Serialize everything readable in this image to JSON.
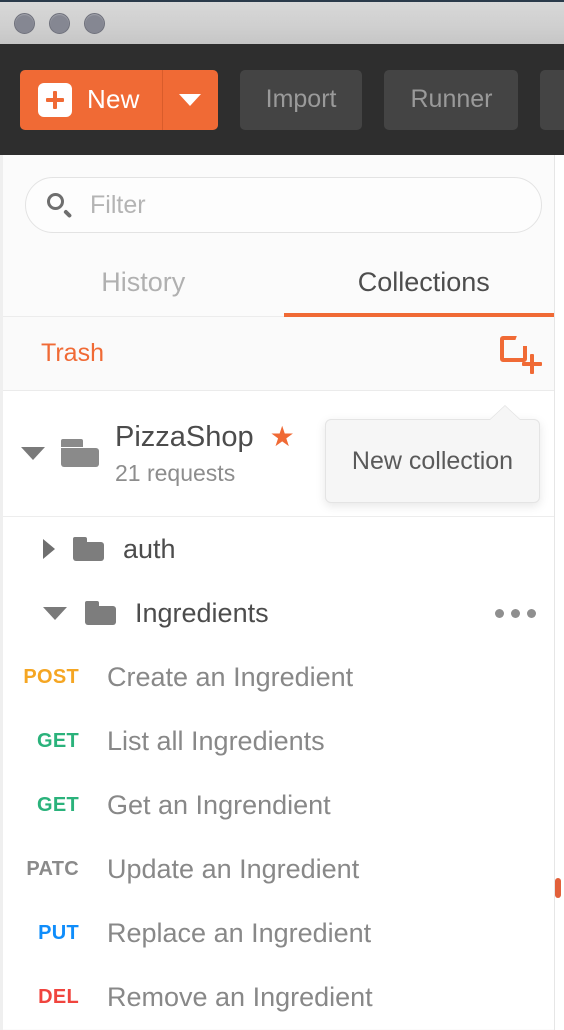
{
  "window": {
    "traffic_lights": [
      "close-button",
      "minimize-button",
      "zoom-button"
    ]
  },
  "toolbar": {
    "new_label": "New",
    "new_plus_icon": "plus-icon",
    "new_caret_icon": "chevron-down-icon",
    "import_label": "Import",
    "runner_label": "Runner",
    "clipped_button_label": ""
  },
  "search": {
    "placeholder": "Filter",
    "value": "",
    "icon": "search-icon"
  },
  "tabs": [
    {
      "label": "History",
      "active": false
    },
    {
      "label": "Collections",
      "active": true
    }
  ],
  "trash_bar": {
    "trash_label": "Trash",
    "new_collection_icon": "new-collection-icon"
  },
  "tooltip": {
    "text": "New collection"
  },
  "collection": {
    "toggle_icon": "chevron-down-icon",
    "folder_icon": "collection-folder-icon",
    "name": "PizzaShop",
    "starred": true,
    "star_glyph": "★",
    "request_count": "21 requests"
  },
  "folders": [
    {
      "name": "auth",
      "expanded": false,
      "toggle_icon": "chevron-right-icon",
      "has_menu": false
    },
    {
      "name": "Ingredients",
      "expanded": true,
      "toggle_icon": "chevron-down-icon",
      "has_menu": true,
      "menu_icon": "ellipsis-icon"
    }
  ],
  "requests": [
    {
      "method": "POST",
      "method_color": "#f5a623",
      "name": "Create an Ingredient"
    },
    {
      "method": "GET",
      "method_color": "#2ab27b",
      "name": "List all Ingredients"
    },
    {
      "method": "GET",
      "method_color": "#2ab27b",
      "name": "Get an Ingrendient"
    },
    {
      "method": "PATC",
      "method_color": "#8a8a8a",
      "name": "Update an Ingredient"
    },
    {
      "method": "PUT",
      "method_color": "#0f8dfb",
      "name": "Replace an Ingredient"
    },
    {
      "method": "DEL",
      "method_color": "#f0443e",
      "name": "Remove an Ingredient"
    }
  ],
  "colors": {
    "accent": "#f06a35",
    "toolbar_bg": "#2e2e2e",
    "sidebar_bg": "#fbfbfb",
    "scrollbar_thumb": "#e2603a"
  }
}
